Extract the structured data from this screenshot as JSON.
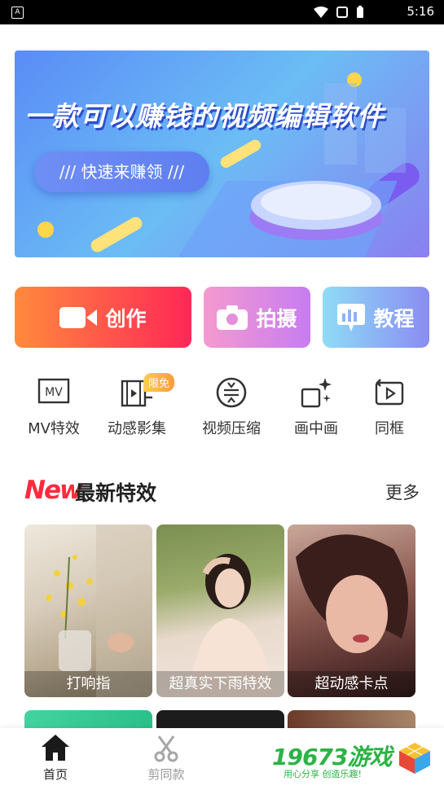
{
  "status_bar": {
    "time": "5:16"
  },
  "banner": {
    "title": "一款可以赚钱的视频编辑软件",
    "pill": "/// 快速来赚领 ///"
  },
  "actions": [
    {
      "label": "创作",
      "icon": "video-camera-icon"
    },
    {
      "label": "拍摄",
      "icon": "camera-icon"
    },
    {
      "label": "教程",
      "icon": "tutorial-icon"
    }
  ],
  "tools": [
    {
      "label": "MV特效",
      "icon": "mv-icon"
    },
    {
      "label": "动感影集",
      "icon": "film-album-icon",
      "tag": "限免"
    },
    {
      "label": "视频压缩",
      "icon": "compress-icon"
    },
    {
      "label": "画中画",
      "icon": "picture-in-picture-icon"
    },
    {
      "label": "同框",
      "icon": "same-frame-icon"
    }
  ],
  "section": {
    "logo": "New",
    "title": "最新特效",
    "more": "更多"
  },
  "cards": [
    {
      "caption": "打响指"
    },
    {
      "caption": "超真实下雨特效"
    },
    {
      "caption": "超动感卡点"
    }
  ],
  "bottom_nav": [
    {
      "label": "首页",
      "icon": "home-icon",
      "active": true
    },
    {
      "label": "剪同款",
      "icon": "scissors-icon",
      "active": false
    }
  ],
  "ad": {
    "brand": "19673游戏",
    "slogan": "用心分享 创造乐趣!"
  },
  "colors": {
    "primary_gradient": [
      "#ff8a3d",
      "#ff2757"
    ],
    "accent": "#ff2b3d",
    "nav_active": "#222222",
    "nav_inactive": "#999999"
  }
}
